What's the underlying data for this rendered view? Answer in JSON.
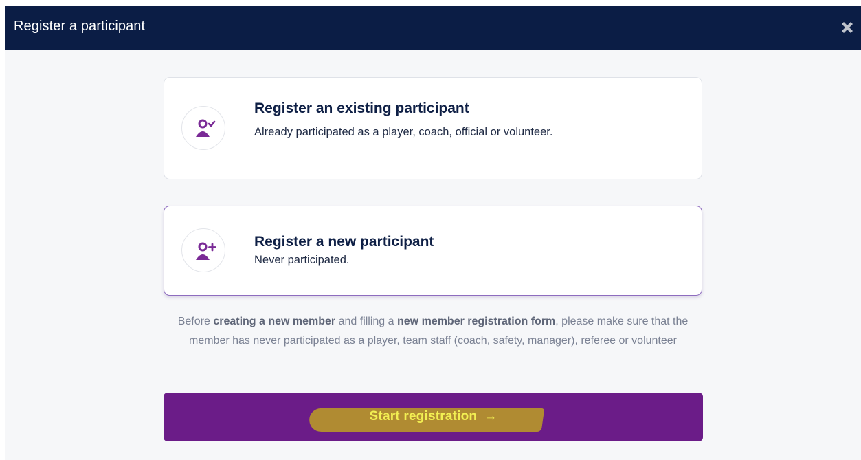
{
  "dialog": {
    "title": "Register a participant",
    "close_icon": "close-icon"
  },
  "options": {
    "existing": {
      "title": "Register an existing participant",
      "description": "Already participated as a player, coach, official or volunteer.",
      "icon": "user-check-icon"
    },
    "new": {
      "title": "Register a new participant",
      "description": "Never participated.",
      "icon": "user-plus-icon",
      "selected": true
    }
  },
  "note": {
    "part1": "Before ",
    "bold1": "creating a new member",
    "part2": " and filling a ",
    "bold2": "new member registration form",
    "part3": ", please make sure that the member has never participated as a player, team staff (coach, safety, manager), referee or volunteer"
  },
  "start_button": {
    "label": "Start registration",
    "arrow": "→"
  },
  "colors": {
    "header_bg": "#0b1d45",
    "accent_purple": "#6b1c88",
    "icon_purple": "#7a2a96",
    "highlight_marker": "#b4912d",
    "button_text": "#f2ef52"
  }
}
